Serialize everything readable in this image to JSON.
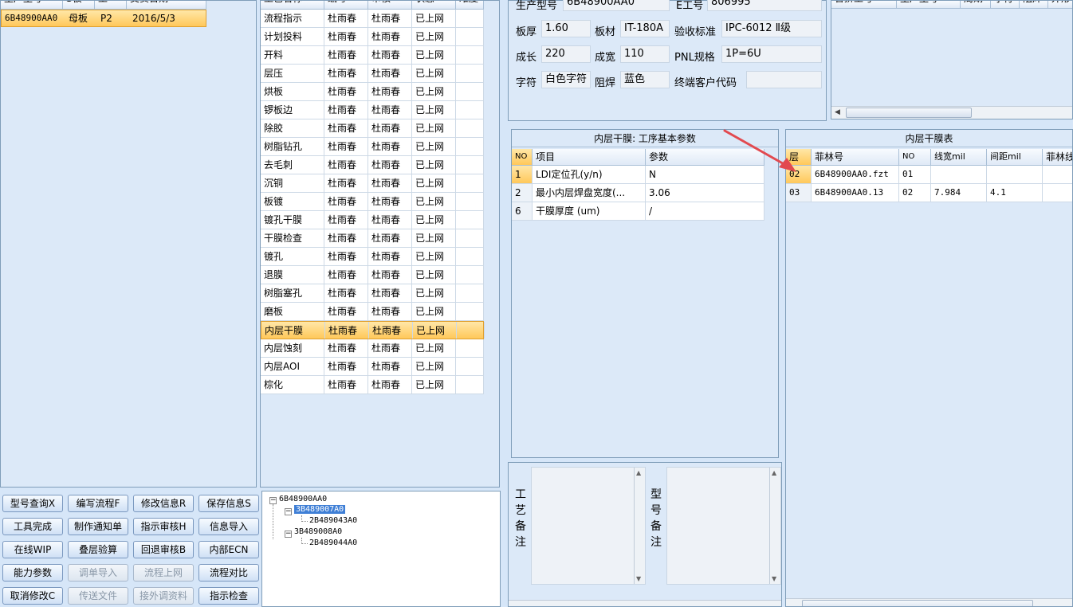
{
  "lotGrid": {
    "columns": [
      "生产型号",
      "S板",
      "工",
      "交货日期"
    ],
    "rows": [
      {
        "model": "6B48900AA0",
        "board": "母板",
        "work": "P2",
        "date": "2016/5/3"
      }
    ]
  },
  "procGrid": {
    "columns": [
      "工艺名称",
      "编写",
      "审核",
      "状态",
      "难度"
    ],
    "rows": [
      {
        "name": "流程指示",
        "writer": "杜雨春",
        "reviewer": "杜雨春",
        "status": "已上网"
      },
      {
        "name": "计划投料",
        "writer": "杜雨春",
        "reviewer": "杜雨春",
        "status": "已上网"
      },
      {
        "name": "开料",
        "writer": "杜雨春",
        "reviewer": "杜雨春",
        "status": "已上网"
      },
      {
        "name": "层压",
        "writer": "杜雨春",
        "reviewer": "杜雨春",
        "status": "已上网"
      },
      {
        "name": "烘板",
        "writer": "杜雨春",
        "reviewer": "杜雨春",
        "status": "已上网"
      },
      {
        "name": "锣板边",
        "writer": "杜雨春",
        "reviewer": "杜雨春",
        "status": "已上网"
      },
      {
        "name": "除胶",
        "writer": "杜雨春",
        "reviewer": "杜雨春",
        "status": "已上网"
      },
      {
        "name": "树脂钻孔",
        "writer": "杜雨春",
        "reviewer": "杜雨春",
        "status": "已上网"
      },
      {
        "name": "去毛刺",
        "writer": "杜雨春",
        "reviewer": "杜雨春",
        "status": "已上网"
      },
      {
        "name": "沉铜",
        "writer": "杜雨春",
        "reviewer": "杜雨春",
        "status": "已上网"
      },
      {
        "name": "板镀",
        "writer": "杜雨春",
        "reviewer": "杜雨春",
        "status": "已上网"
      },
      {
        "name": "镀孔干膜",
        "writer": "杜雨春",
        "reviewer": "杜雨春",
        "status": "已上网"
      },
      {
        "name": "干膜检查",
        "writer": "杜雨春",
        "reviewer": "杜雨春",
        "status": "已上网"
      },
      {
        "name": "镀孔",
        "writer": "杜雨春",
        "reviewer": "杜雨春",
        "status": "已上网"
      },
      {
        "name": "退膜",
        "writer": "杜雨春",
        "reviewer": "杜雨春",
        "status": "已上网"
      },
      {
        "name": "树脂塞孔",
        "writer": "杜雨春",
        "reviewer": "杜雨春",
        "status": "已上网"
      },
      {
        "name": "磨板",
        "writer": "杜雨春",
        "reviewer": "杜雨春",
        "status": "已上网"
      },
      {
        "name": "内层干膜",
        "writer": "杜雨春",
        "reviewer": "杜雨春",
        "status": "已上网"
      },
      {
        "name": "内层蚀刻",
        "writer": "杜雨春",
        "reviewer": "杜雨春",
        "status": "已上网"
      },
      {
        "name": "内层AOI",
        "writer": "杜雨春",
        "reviewer": "杜雨春",
        "status": "已上网"
      },
      {
        "name": "棕化",
        "writer": "杜雨春",
        "reviewer": "杜雨春",
        "status": "已上网"
      }
    ]
  },
  "buttons": [
    {
      "label": "型号查询X",
      "enabled": true
    },
    {
      "label": "编写流程F",
      "enabled": true
    },
    {
      "label": "修改信息R",
      "enabled": true
    },
    {
      "label": "保存信息S",
      "enabled": true
    },
    {
      "label": "工具完成",
      "enabled": true
    },
    {
      "label": "制作通知单",
      "enabled": true
    },
    {
      "label": "指示审核H",
      "enabled": true
    },
    {
      "label": "信息导入",
      "enabled": true
    },
    {
      "label": "在线WIP",
      "enabled": true
    },
    {
      "label": "叠层验算",
      "enabled": true
    },
    {
      "label": "回退审核B",
      "enabled": true
    },
    {
      "label": "内部ECN",
      "enabled": true
    },
    {
      "label": "能力参数",
      "enabled": true
    },
    {
      "label": "调单导入",
      "enabled": false
    },
    {
      "label": "流程上网",
      "enabled": false
    },
    {
      "label": "流程对比",
      "enabled": true
    },
    {
      "label": "取消修改C",
      "enabled": true
    },
    {
      "label": "传送文件",
      "enabled": false
    },
    {
      "label": "接外调资料",
      "enabled": false
    },
    {
      "label": "指示检查",
      "enabled": true
    }
  ],
  "tree": {
    "root": "6B48900AA0",
    "child1": "3B489007A0",
    "child1_1": "2B489043A0",
    "child2": "3B489008A0",
    "child2_1": "2B489044A0"
  },
  "info": {
    "model_label": "生产型号",
    "model_value": "6B48900AA0",
    "e_label": "E工号",
    "e_value": "806995",
    "thick_label": "板厚",
    "thick_value": "1.60",
    "material_label": "板材",
    "material_value": "IT-180A",
    "std_label": "验收标准",
    "std_value": "IPC-6012 Ⅱ级",
    "len_label": "成长",
    "len_value": "220",
    "width_label": "成宽",
    "width_value": "110",
    "pnl_label": "PNL规格",
    "pnl_value": "1P=6U",
    "char_label": "字符",
    "char_value": "白色字符",
    "mask_label": "阻焊",
    "mask_value": "蓝色",
    "cust_label": "终端客户代码",
    "cust_value": ""
  },
  "rtGrid": {
    "columns": [
      "合拼工号",
      "生产型号",
      "周期",
      "字符",
      "阻焊",
      "外形"
    ]
  },
  "paramPanel": {
    "title": "内层干膜: 工序基本参数",
    "columns": [
      "NO",
      "项目",
      "参数"
    ],
    "rows": [
      {
        "no": "1",
        "item": "LDI定位孔(y/n)",
        "value": "N"
      },
      {
        "no": "2",
        "item": "最小内层焊盘宽度(...",
        "value": "3.06"
      },
      {
        "no": "6",
        "item": "干膜厚度 (um)",
        "value": "/"
      }
    ]
  },
  "filmPanel": {
    "title": "内层干膜表",
    "columns": [
      "层",
      "菲林号",
      "NO",
      "线宽mil",
      "间距mil",
      "菲林线"
    ],
    "rows": [
      {
        "layer": "02",
        "film": "6B48900AA0.fzt",
        "no": "01",
        "lw": "",
        "sp": ""
      },
      {
        "layer": "03",
        "film": "6B48900AA0.13",
        "no": "02",
        "lw": "7.984",
        "sp": "4.1"
      }
    ]
  },
  "remarks": {
    "process_label": "工艺备注",
    "model_label": "型号备注"
  }
}
